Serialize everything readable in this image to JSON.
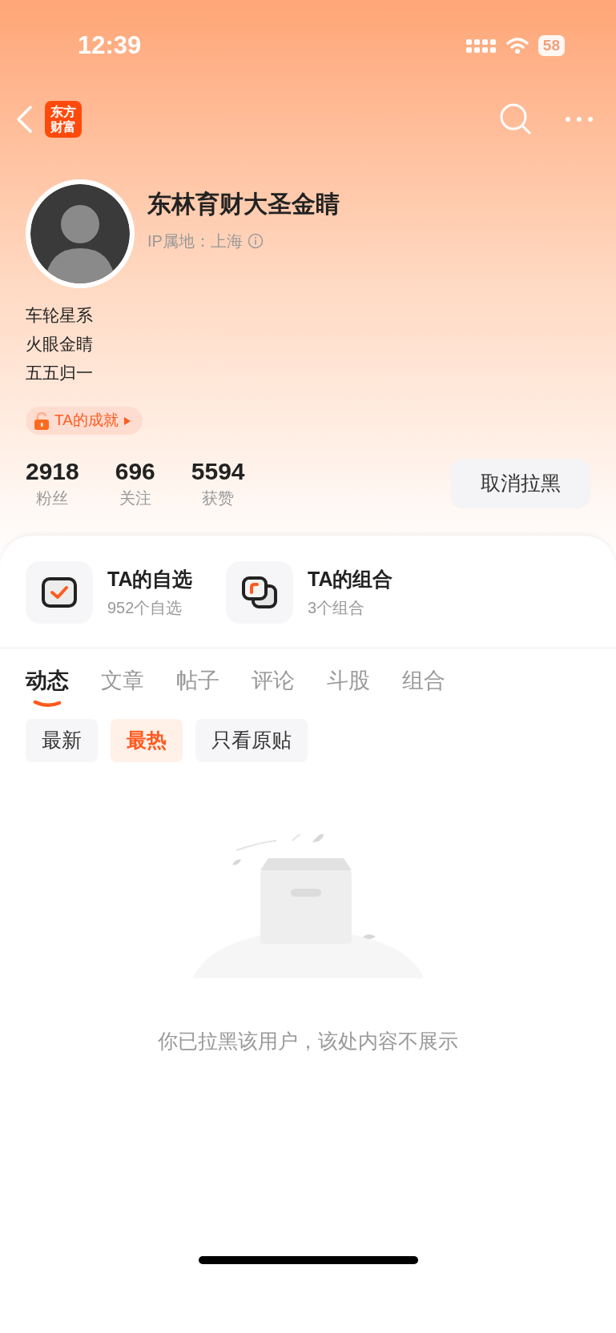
{
  "status_bar": {
    "time": "12:39",
    "battery": "58"
  },
  "nav": {
    "logo_lines": [
      "东方",
      "财富"
    ]
  },
  "profile": {
    "name": "东林育财大圣金睛",
    "ip_label": "IP属地：上海",
    "bio": [
      "车轮星系",
      "火眼金睛",
      "五五归一"
    ],
    "achievement": "TA的成就"
  },
  "stats": [
    {
      "value": "2918",
      "label": "粉丝"
    },
    {
      "value": "696",
      "label": "关注"
    },
    {
      "value": "5594",
      "label": "获赞"
    }
  ],
  "unblock_button": "取消拉黑",
  "shortcuts": [
    {
      "kind": "watchlist",
      "title": "TA的自选",
      "subtitle": "952个自选"
    },
    {
      "kind": "portfolio",
      "title": "TA的组合",
      "subtitle": "3个组合"
    }
  ],
  "tabs": [
    {
      "label": "动态",
      "selected": true
    },
    {
      "label": "文章",
      "selected": false
    },
    {
      "label": "帖子",
      "selected": false
    },
    {
      "label": "评论",
      "selected": false
    },
    {
      "label": "斗股",
      "selected": false
    },
    {
      "label": "组合",
      "selected": false
    }
  ],
  "filters": [
    {
      "label": "最新",
      "selected": false
    },
    {
      "label": "最热",
      "selected": true
    },
    {
      "label": "只看原贴",
      "selected": false
    }
  ],
  "empty_message": "你已拉黑该用户，该处内容不展示"
}
